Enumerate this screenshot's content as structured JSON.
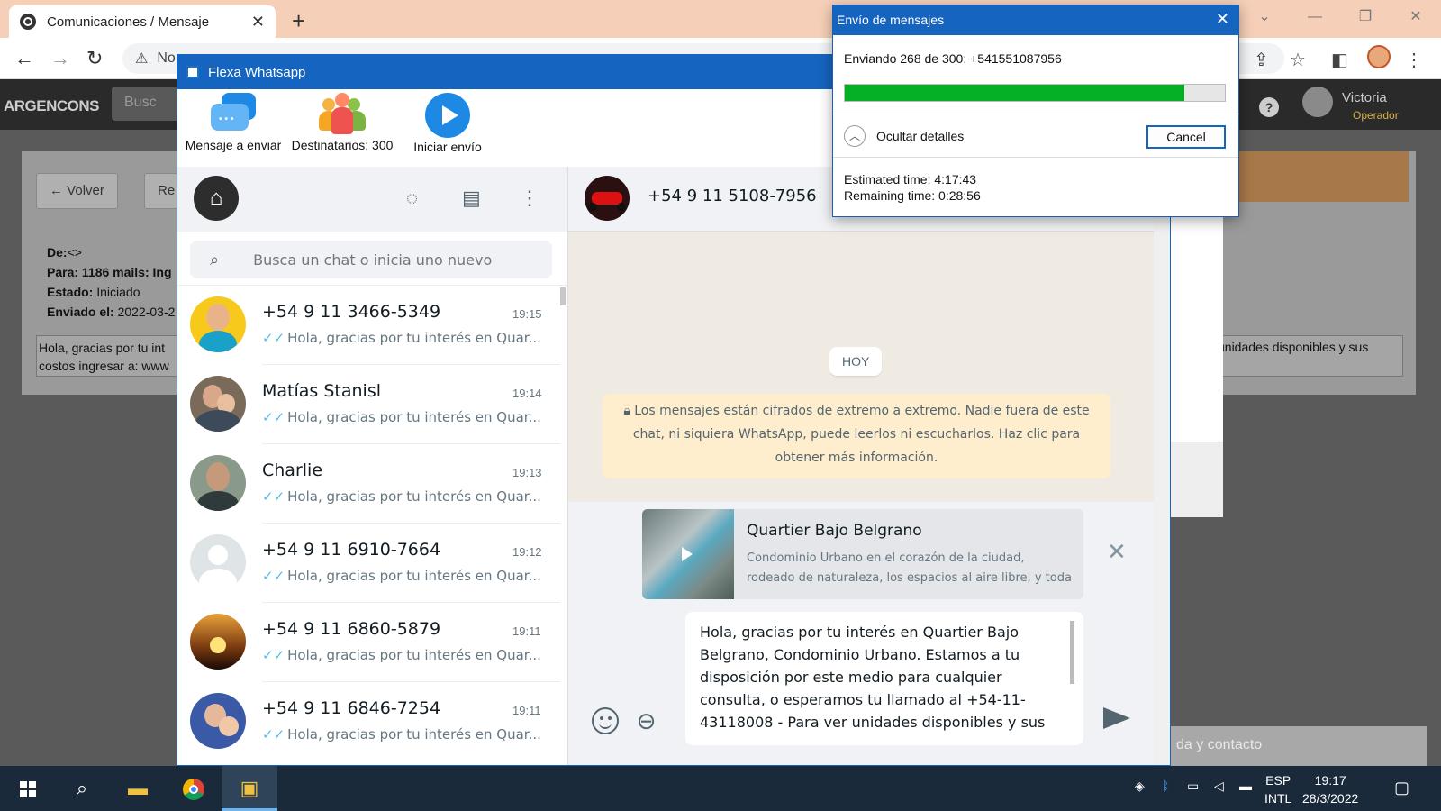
{
  "browser": {
    "tab_title": "Comunicaciones / Mensaje",
    "url_partial": "No",
    "new_tab": "+"
  },
  "webapp": {
    "logo": "ARGENCONS",
    "search_placeholder": "Busc",
    "user_name": "Victoria",
    "user_role": "Operador",
    "help": "?",
    "back_label": "Volver",
    "second_btn_label": "Re",
    "meta": {
      "de_label": "De:",
      "de_value": "<>",
      "para_label": "Para:",
      "para_value": "1186 mails: Ing",
      "estado_label": "Estado:",
      "estado_value": "Iniciado",
      "enviado_label": "Enviado el:",
      "enviado_value": "2022-03-2"
    },
    "body_line1": "Hola, gracias por tu int",
    "body_line2": "costos ingresar a: www",
    "body_right": "unidades disponibles y sus",
    "bottom_bar": "da y contacto"
  },
  "flexa": {
    "window_title": "Flexa Whatsapp",
    "tools": {
      "message": "Mensaje a enviar",
      "recipients": "Destinatarios: 300",
      "start": "Iniciar envío"
    }
  },
  "whatsapp": {
    "search_placeholder": "Busca un chat o inicia uno nuevo",
    "chats": [
      {
        "name": "+54 9 11 3466-5349",
        "time": "19:15",
        "preview": "Hola, gracias por tu interés en Quar..."
      },
      {
        "name": "Matías Stanisl",
        "time": "19:14",
        "preview": "Hola, gracias por tu interés en Quar..."
      },
      {
        "name": "Charlie",
        "time": "19:13",
        "preview": "Hola, gracias por tu interés en Quar..."
      },
      {
        "name": "+54 9 11 6910-7664",
        "time": "19:12",
        "preview": "Hola, gracias por tu interés en Quar..."
      },
      {
        "name": "+54 9 11 6860-5879",
        "time": "19:11",
        "preview": "Hola, gracias por tu interés en Quar..."
      },
      {
        "name": "+54 9 11 6846-7254",
        "time": "19:11",
        "preview": "Hola, gracias por tu interés en Quar..."
      }
    ],
    "active_contact": "+54 9 11 5108-7956",
    "day_label": "HOY",
    "encryption_notice": "Los mensajes están cifrados de extremo a extremo. Nadie fuera de este chat, ni siquiera WhatsApp, puede leerlos ni escucharlos. Haz clic para obtener más información.",
    "link_preview": {
      "title": "Quartier Bajo Belgrano",
      "description": "Condominio Urbano en el corazón de la ciudad, rodeado de naturaleza, los espacios al aire libre, y toda"
    },
    "draft": "Hola, gracias por tu interés en Quartier Bajo Belgrano, Condominio Urbano. Estamos a tu disposición por este medio para cualquier consulta, o esperamos tu llamado al +54-11-43118008  - Para ver unidades disponibles y sus"
  },
  "dialog": {
    "title": "Envío de mensajes",
    "status": "Enviando 268 de 300: +541551087956",
    "progress_fraction": 0.893,
    "toggle_label": "Ocultar detalles",
    "cancel_label": "Cancel",
    "estimated": "Estimated time: 4:17:43",
    "remaining": "Remaining time: 0:28:56"
  },
  "taskbar": {
    "lang_top": "ESP",
    "lang_bottom": "INTL",
    "time": "19:17",
    "date": "28/3/2022"
  },
  "colors": {
    "whatsapp_titlebar": "#1565c0",
    "progress_green": "#06b025",
    "tick_blue": "#53bdeb",
    "encryption_bg": "#ffeecd"
  }
}
